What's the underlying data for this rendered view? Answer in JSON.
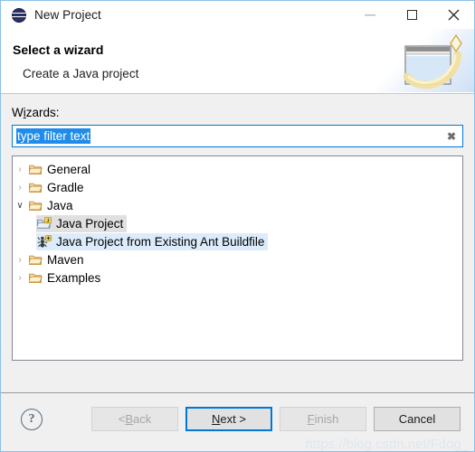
{
  "window": {
    "title": "New Project",
    "app_icon": "eclipse-icon",
    "controls": {
      "minimize": "—",
      "maximize": "□",
      "close": "✕"
    }
  },
  "banner": {
    "title": "Select a wizard",
    "subtitle": "Create a Java project",
    "art": "wizard-wand-window-graphic"
  },
  "form": {
    "wizards_label_pre": "W",
    "wizards_label_mnemonic": "i",
    "wizards_label_post": "zards:",
    "filter": {
      "value": "type filter text",
      "placeholder": "type filter text",
      "clear_icon": "✖"
    }
  },
  "tree": {
    "items": [
      {
        "label": "General",
        "icon": "folder-icon",
        "twisty": "›",
        "expanded": false,
        "indent": false,
        "state": "none"
      },
      {
        "label": "Gradle",
        "icon": "folder-icon",
        "twisty": "›",
        "expanded": false,
        "indent": false,
        "state": "none"
      },
      {
        "label": "Java",
        "icon": "folder-icon",
        "twisty": "∨",
        "expanded": true,
        "indent": false,
        "state": "none"
      },
      {
        "label": "Java Project",
        "icon": "java-project-icon",
        "twisty": "",
        "expanded": false,
        "indent": true,
        "state": "selected"
      },
      {
        "label": "Java Project from Existing Ant Buildfile",
        "icon": "ant-buildfile-icon",
        "twisty": "",
        "expanded": false,
        "indent": true,
        "state": "hover"
      },
      {
        "label": "Maven",
        "icon": "folder-icon",
        "twisty": "›",
        "expanded": false,
        "indent": false,
        "state": "none"
      },
      {
        "label": "Examples",
        "icon": "folder-icon",
        "twisty": "›",
        "expanded": false,
        "indent": false,
        "state": "none"
      }
    ]
  },
  "footer": {
    "help_icon": "?",
    "buttons": [
      {
        "label_pre": "< ",
        "label_mnemonic": "B",
        "label_post": "ack",
        "state": "disabled",
        "name": "back-button"
      },
      {
        "label_pre": "",
        "label_mnemonic": "N",
        "label_post": "ext >",
        "state": "focused",
        "name": "next-button"
      },
      {
        "label_pre": "",
        "label_mnemonic": "F",
        "label_post": "inish",
        "state": "disabled",
        "name": "finish-button"
      },
      {
        "label_pre": "",
        "label_mnemonic": "",
        "label_post": "Cancel",
        "state": "enabled",
        "name": "cancel-button"
      }
    ]
  },
  "watermark": "https://blog.csdn.net/Fdog_",
  "colors": {
    "accent": "#0078d7",
    "selection_blue": "#1f8ceb",
    "hover_row": "#dcecfb",
    "selected_row": "#e0e0e0",
    "window_border": "#88c0e8"
  }
}
